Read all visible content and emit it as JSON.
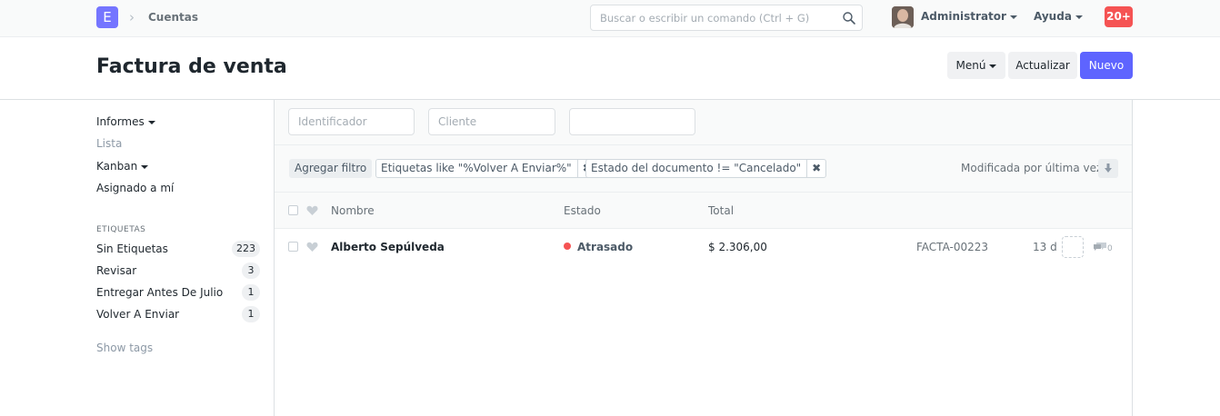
{
  "navbar": {
    "logo_letter": "E",
    "breadcrumb": "Cuentas",
    "search_placeholder": "Buscar o escribir un comando (Ctrl + G)",
    "user": "Administrator",
    "help": "Ayuda",
    "notifications": "20+"
  },
  "page": {
    "title": "Factura de venta",
    "menu_label": "Menú",
    "refresh_label": "Actualizar",
    "new_label": "Nuevo"
  },
  "sidebar": {
    "items": [
      {
        "label": "Informes"
      },
      {
        "label": "Lista"
      },
      {
        "label": "Kanban"
      },
      {
        "label": "Asignado a mí"
      }
    ],
    "tags_heading": "ETIQUETAS",
    "tags": [
      {
        "label": "Sin Etiquetas",
        "count": "223"
      },
      {
        "label": "Revisar",
        "count": "3"
      },
      {
        "label": "Entregar Antes De Julio",
        "count": "1"
      },
      {
        "label": "Volver A Enviar",
        "count": "1"
      }
    ],
    "show_tags": "Show tags"
  },
  "filters": {
    "id_placeholder": "Identificador",
    "customer_placeholder": "Cliente",
    "third_value": "",
    "add_filter": "Agregar filtro",
    "chips": [
      "Etiquetas like \"%Volver A Enviar%\"",
      "Estado del documento != \"Cancelado\""
    ],
    "sort_label": "Modificada por última vez"
  },
  "list": {
    "columns": [
      "Nombre",
      "Estado",
      "Total"
    ],
    "rows": [
      {
        "name": "Alberto Sepúlveda",
        "status": "Atrasado",
        "total": "$ 2.306,00",
        "id": "FACTA-00223",
        "modified": "13 d",
        "comments": "0"
      }
    ]
  },
  "colors": {
    "accent": "#5e64ff",
    "logo": "#7575ff",
    "overdue": "#f55353"
  }
}
